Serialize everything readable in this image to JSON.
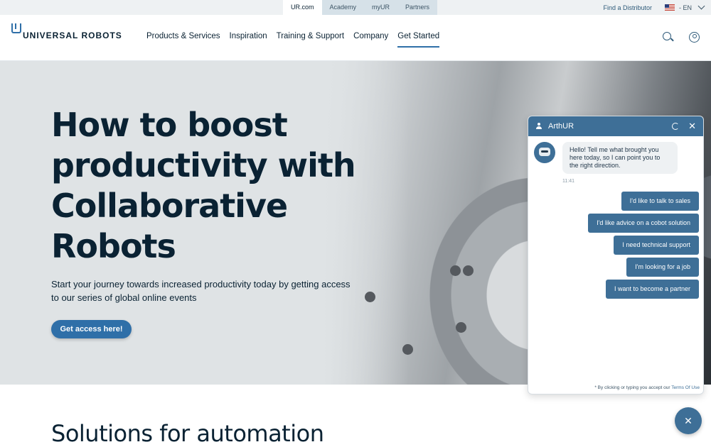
{
  "utility_bar": {
    "tabs": [
      {
        "label": "UR.com",
        "active": true
      },
      {
        "label": "Academy",
        "active": false
      },
      {
        "label": "myUR",
        "active": false
      },
      {
        "label": "Partners",
        "active": false
      }
    ],
    "distributor_link": "Find a Distributor",
    "language": "- EN"
  },
  "nav": {
    "logo_text": "UNIVERSAL ROBOTS",
    "items": [
      {
        "label": "Products & Services"
      },
      {
        "label": "Inspiration"
      },
      {
        "label": "Training & Support"
      },
      {
        "label": "Company"
      },
      {
        "label": "Get Started",
        "active": true
      }
    ],
    "icons": [
      "search-icon",
      "user-icon"
    ]
  },
  "hero": {
    "title": "How to boost productivity with Collaborative Robots",
    "subtitle": "Start your journey towards increased productivity today by getting access to our series of global online events",
    "cta": "Get access here!"
  },
  "section": {
    "title": "Solutions for automation"
  },
  "chat": {
    "title": "ArthUR",
    "bot_message": "Hello! Tell me what brought you here today, so I can point you to the right direction.",
    "time": "11:41",
    "options": [
      "I'd like to talk to sales",
      "I'd like advice on a cobot solution",
      "I need technical support",
      "I'm looking for a job",
      "I want to become a partner"
    ],
    "footer_text": "* By clicking or typing you accept our",
    "footer_link": "Terms Of Use"
  },
  "colors": {
    "accent": "#2f6fa8",
    "chat_header": "#3e6f97",
    "text_dark": "#0a2233"
  }
}
